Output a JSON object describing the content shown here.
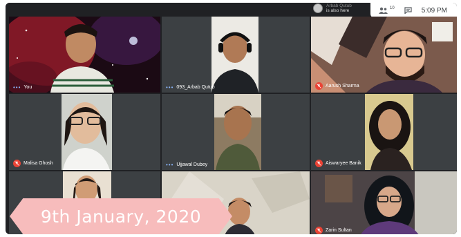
{
  "status_bar": {
    "presenter_name": "Arbab Qutub",
    "presenter_text": "is also here",
    "people_count": "10",
    "time": "5:09 PM"
  },
  "participants": [
    {
      "name": "You",
      "muted": false
    },
    {
      "name": "093_Arbab Qutub",
      "muted": false
    },
    {
      "name": "Aarush Sharma",
      "muted": true
    },
    {
      "name": "Malisa Ghosh",
      "muted": true
    },
    {
      "name": "Ujjawal Dubey",
      "muted": false
    },
    {
      "name": "Aiswaryee Banik",
      "muted": true
    },
    {
      "name": "",
      "muted": false
    },
    {
      "name": "",
      "muted": false
    },
    {
      "name": "Zarin Sultan",
      "muted": true
    }
  ],
  "banner": {
    "text": "9th January, 2020",
    "color": "#f7bcbc"
  },
  "colors": {
    "background": "#202124",
    "tile_dark": "#3c4043",
    "mic_off": "#ea4335",
    "speaking_dots": "#8ab4f8"
  }
}
